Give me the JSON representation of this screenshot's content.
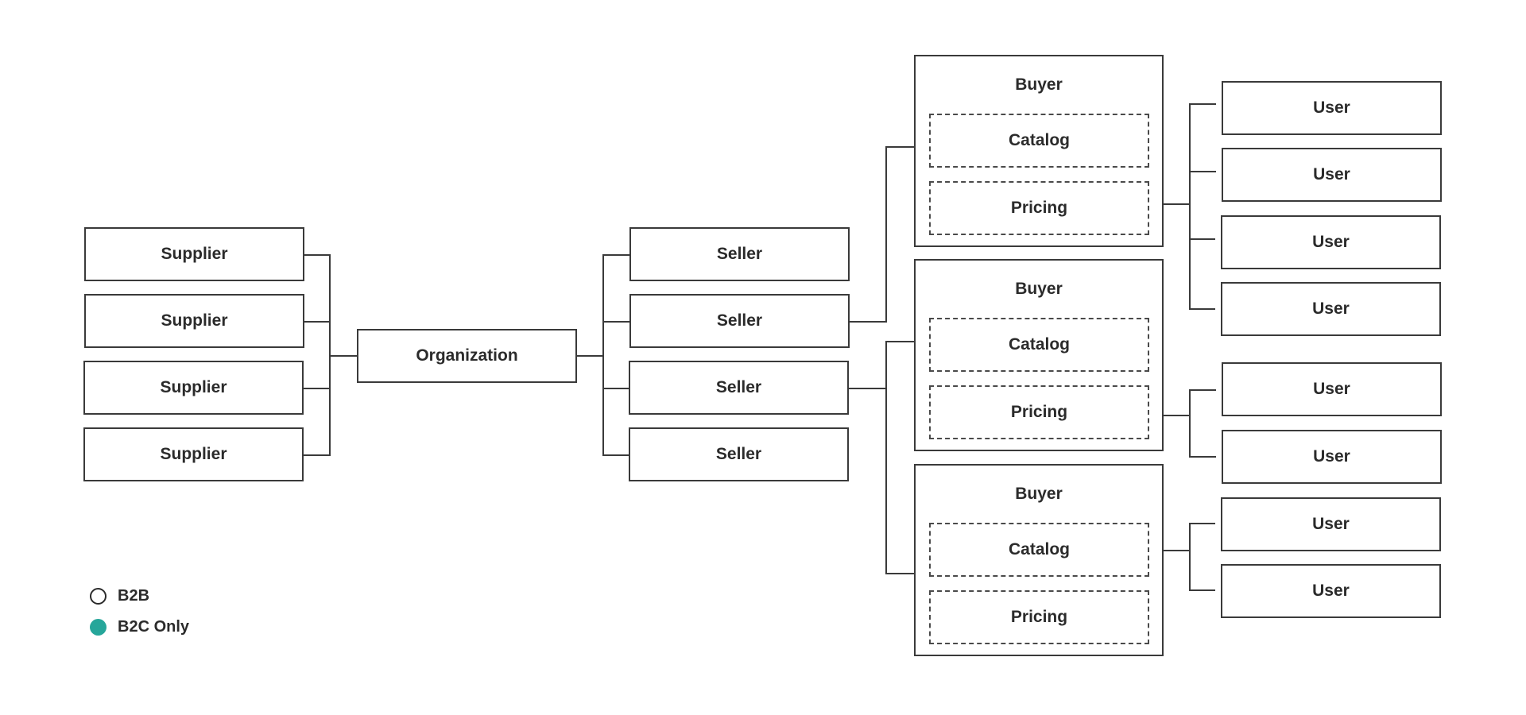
{
  "suppliers": [
    "Supplier",
    "Supplier",
    "Supplier",
    "Supplier"
  ],
  "organization": "Organization",
  "sellers": [
    "Seller",
    "Seller",
    "Seller",
    "Seller"
  ],
  "buyers": [
    {
      "title": "Buyer",
      "catalog": "Catalog",
      "pricing": "Pricing"
    },
    {
      "title": "Buyer",
      "catalog": "Catalog",
      "pricing": "Pricing"
    },
    {
      "title": "Buyer",
      "catalog": "Catalog",
      "pricing": "Pricing"
    }
  ],
  "users": [
    "User",
    "User",
    "User",
    "User",
    "User",
    "User",
    "User",
    "User"
  ],
  "legend": [
    {
      "label": "B2B",
      "marker": "hollow-circle",
      "color": "#ffffff"
    },
    {
      "label": "B2C Only",
      "marker": "filled-circle",
      "color": "#26a69a"
    }
  ]
}
